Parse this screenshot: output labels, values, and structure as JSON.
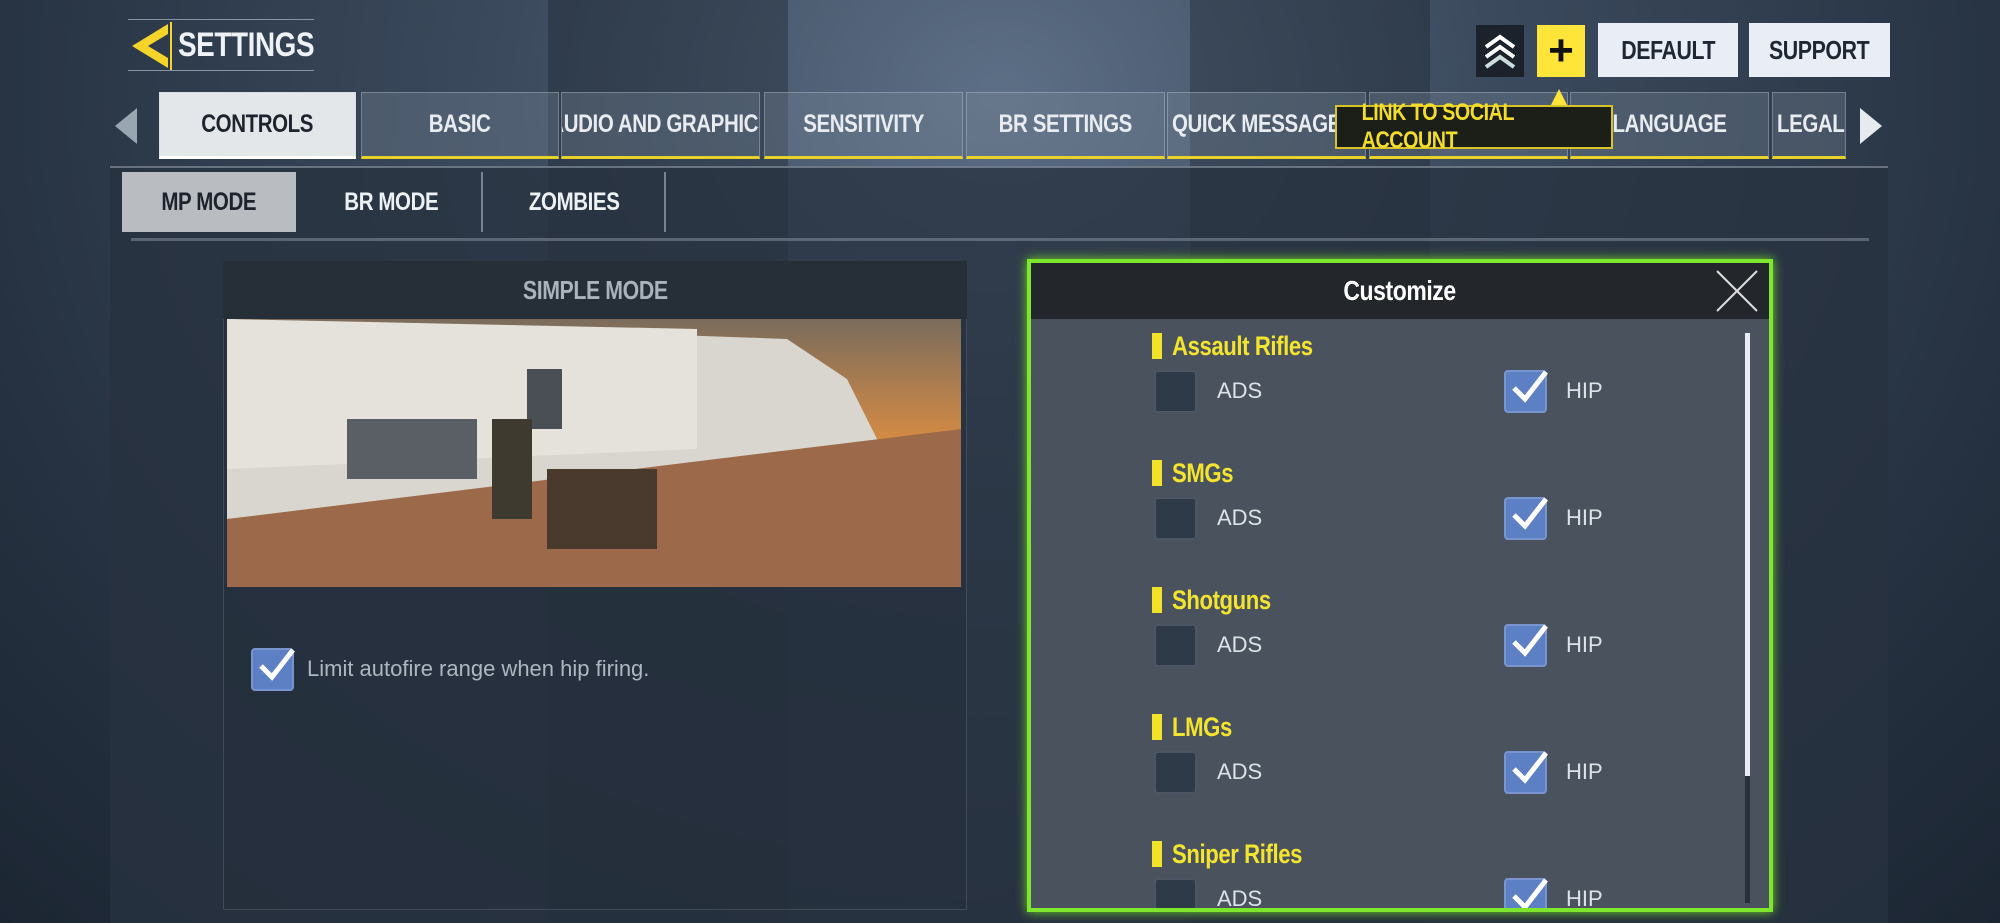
{
  "header": {
    "title": "SETTINGS",
    "default_label": "DEFAULT",
    "support_label": "SUPPORT",
    "plus_label": "+",
    "rank_icon": "rank-chevrons-icon"
  },
  "tabs": [
    {
      "label": "CONTROLS",
      "active": true
    },
    {
      "label": "BASIC"
    },
    {
      "label": "AUDIO AND GRAPHICS"
    },
    {
      "label": "SENSITIVITY"
    },
    {
      "label": "BR SETTINGS"
    },
    {
      "label": "QUICK MESSAGE"
    },
    {
      "label": ""
    },
    {
      "label": "LANGUAGE"
    },
    {
      "label": "LEGAL A"
    }
  ],
  "tooltip": "LINK TO SOCIAL ACCOUNT",
  "subtabs": [
    {
      "label": "MP MODE",
      "active": true
    },
    {
      "label": "BR MODE"
    },
    {
      "label": "ZOMBIES"
    }
  ],
  "left_panel": {
    "title": "SIMPLE MODE",
    "limit_autofire": {
      "label": "Limit autofire range when hip firing.",
      "checked": true
    }
  },
  "customize": {
    "title": "Customize",
    "categories": [
      {
        "name": "Assault Rifles",
        "ads_label": "ADS",
        "ads": false,
        "hip_label": "HIP",
        "hip": true
      },
      {
        "name": "SMGs",
        "ads_label": "ADS",
        "ads": false,
        "hip_label": "HIP",
        "hip": true
      },
      {
        "name": "Shotguns",
        "ads_label": "ADS",
        "ads": false,
        "hip_label": "HIP",
        "hip": true
      },
      {
        "name": "LMGs",
        "ads_label": "ADS",
        "ads": false,
        "hip_label": "HIP",
        "hip": true
      },
      {
        "name": "Sniper Rifles",
        "ads_label": "ADS",
        "ads": false,
        "hip_label": "HIP",
        "hip": true
      }
    ]
  },
  "colors": {
    "accent_yellow": "#ffe53a",
    "highlight_green": "#7ee62c",
    "checkbox_blue": "#5d80c4"
  }
}
